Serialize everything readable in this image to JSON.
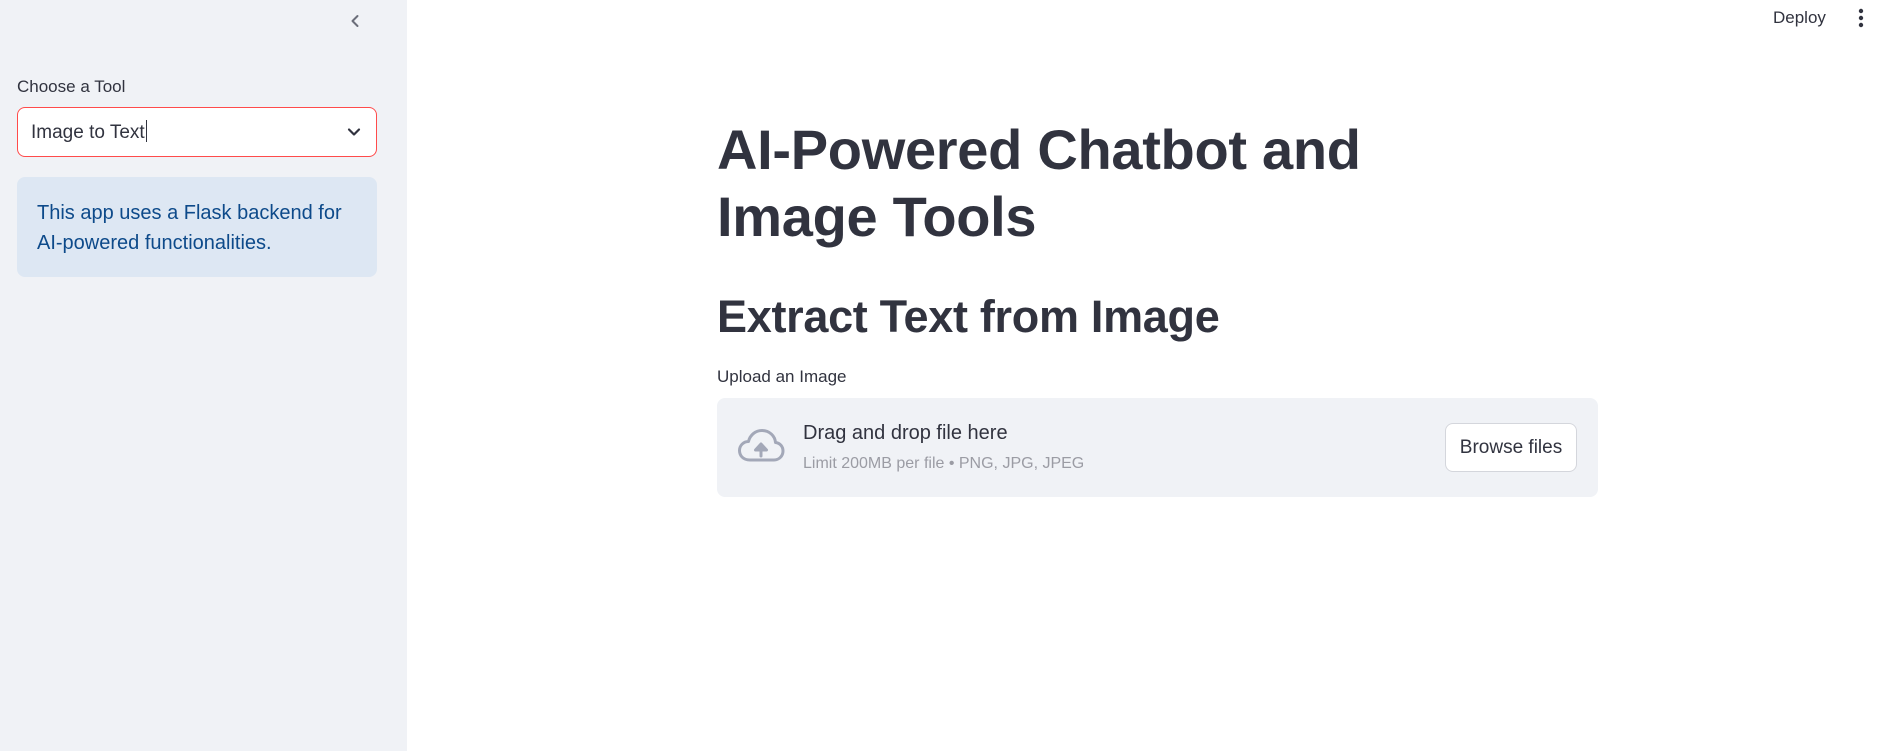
{
  "sidebar": {
    "select": {
      "label": "Choose a Tool",
      "value": "Image to Text"
    },
    "info": {
      "text": "This app uses a Flask backend for AI-powered functionalities."
    }
  },
  "header": {
    "deploy_label": "Deploy"
  },
  "main": {
    "title": "AI-Powered Chatbot and Image Tools",
    "subtitle": "Extract Text from Image",
    "uploader": {
      "label": "Upload an Image",
      "drop_text": "Drag and drop file here",
      "limit_text": "Limit 200MB per file • PNG, JPG, JPEG",
      "browse_label": "Browse files"
    }
  },
  "colors": {
    "accent": "#ff4b4b",
    "sidebar_bg": "#f0f2f6",
    "info_bg": "#dde7f3",
    "info_text": "#0d4a8a",
    "text": "#31333f"
  },
  "icons": {
    "collapse": "chevron-left-icon",
    "select_arrow": "chevron-down-icon",
    "menu": "more-vertical-icon",
    "upload": "cloud-upload-icon"
  }
}
